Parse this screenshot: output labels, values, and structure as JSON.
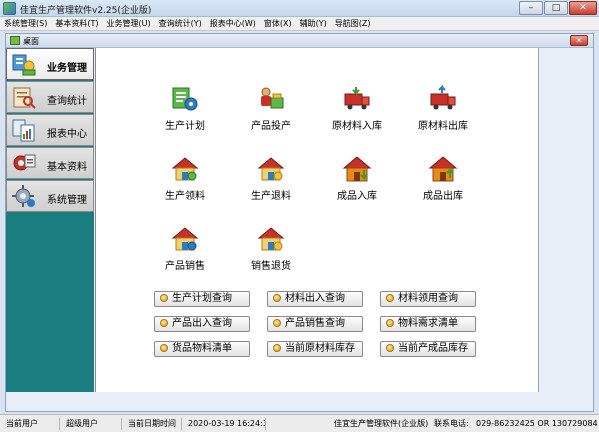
{
  "window": {
    "title": "佳宜生产管理软件v2.25(企业版)",
    "min_glyph": "–",
    "max_glyph": "□",
    "close_glyph": "✕"
  },
  "menu": [
    "系统管理(S)",
    "基本资料(T)",
    "业务管理(U)",
    "查询统计(Y)",
    "报表中心(W)",
    "窗体(X)",
    "辅助(Y)",
    "导航图(Z)"
  ],
  "inner_window": {
    "title": "桌面",
    "close_glyph": "✕"
  },
  "sidebar": [
    {
      "label": "业务管理",
      "icon": "business-icon",
      "active": true
    },
    {
      "label": "查询统计",
      "icon": "query-icon",
      "active": false
    },
    {
      "label": "报表中心",
      "icon": "report-icon",
      "active": false
    },
    {
      "label": "基本资料",
      "icon": "basic-data-icon",
      "active": false
    },
    {
      "label": "系统管理",
      "icon": "system-icon",
      "active": false
    }
  ],
  "tiles": [
    {
      "label": "生产计划",
      "icon": "production-plan-icon"
    },
    {
      "label": "产品投产",
      "icon": "product-start-icon"
    },
    {
      "label": "原材料入库",
      "icon": "material-inbound-icon"
    },
    {
      "label": "原材料出库",
      "icon": "material-outbound-icon"
    },
    {
      "label": "生产领料",
      "icon": "production-pick-icon"
    },
    {
      "label": "生产退料",
      "icon": "production-return-icon"
    },
    {
      "label": "成品入库",
      "icon": "finished-inbound-icon"
    },
    {
      "label": "成品出库",
      "icon": "finished-outbound-icon"
    },
    {
      "label": "产品销售",
      "icon": "product-sales-icon"
    },
    {
      "label": "销售退货",
      "icon": "sales-return-icon"
    }
  ],
  "query_buttons": [
    "生产计划查询",
    "材料出入查询",
    "材料领用查询",
    "产品出入查询",
    "产品销售查询",
    "物料需求清单",
    "货品物料清单",
    "当前原材料库存",
    "当前产成品库存"
  ],
  "status": {
    "user_label": "当前用户",
    "user_value": "超级用户",
    "date_label": "当前日期时间",
    "date_value": "2020-03-19 16:24:3",
    "company": "佳宜生产管理软件(企业版)",
    "phone_label": "联系电话:",
    "phone_value": "029-86232425 OR 13072908445"
  },
  "colors": {
    "sidebar_bg": "#1a7d80",
    "accent_green": "#3a9a2a",
    "accent_red": "#c8302a",
    "house_orange": "#e8891a"
  }
}
